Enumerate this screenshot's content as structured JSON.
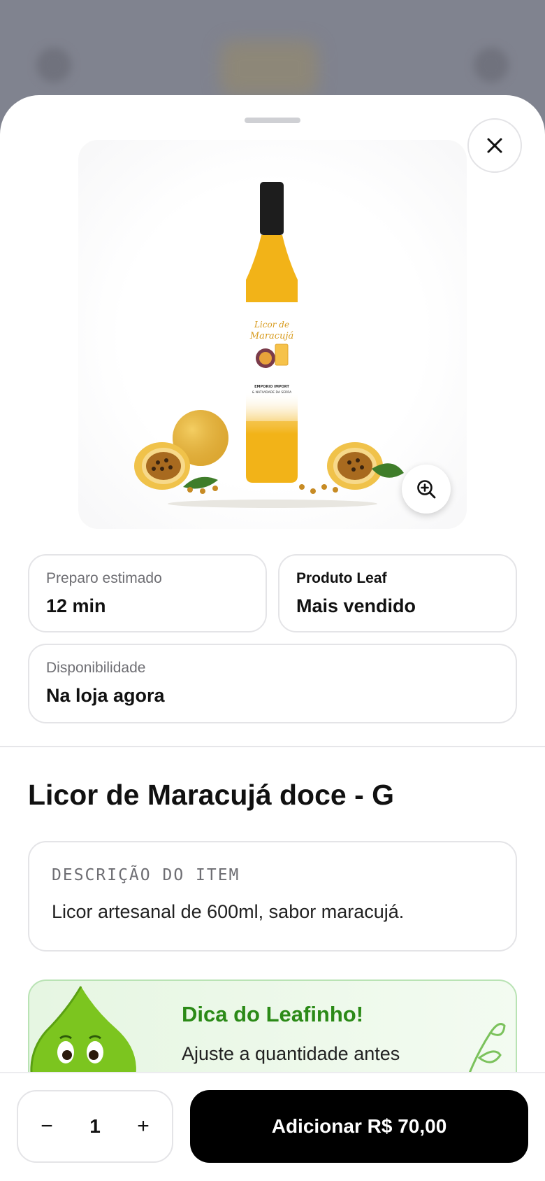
{
  "sheet": {
    "close_icon": "close-icon",
    "zoom_icon": "zoom-in-icon"
  },
  "product_image": {
    "bottle_label_line1": "Licor de",
    "bottle_label_line2": "Maracujá",
    "bottle_brand_line1": "EMPORIO IMPORT",
    "bottle_brand_line2": "& NATIVIDADE DA SERRA"
  },
  "info": {
    "prep_label": "Preparo estimado",
    "prep_value": "12 min",
    "leaf_label": "Produto Leaf",
    "leaf_value": "Mais vendido",
    "availability_label": "Disponibilidade",
    "availability_value": "Na loja agora"
  },
  "product": {
    "title": "Licor de Maracujá doce - G",
    "description_label": "DESCRIÇÃO DO ITEM",
    "description": "Licor artesanal de 600ml, sabor maracujá."
  },
  "tip": {
    "title": "Dica do Leafinho!",
    "text": "Ajuste a quantidade antes"
  },
  "cart": {
    "decrement": "−",
    "quantity": "1",
    "increment": "+",
    "add_button": "Adicionar R$ 70,00"
  },
  "colors": {
    "accent_green": "#2b8a17",
    "button_black": "#000000"
  }
}
